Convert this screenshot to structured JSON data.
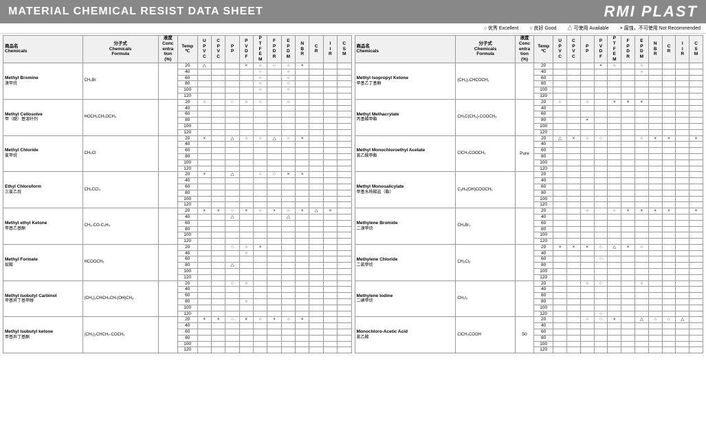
{
  "header": {
    "title": "MATERIAL CHEMICAL RESIST DATA SHEET",
    "logo": "RMI PLAST"
  },
  "legend": {
    "excellent": "优秀 Excellent",
    "good": "良好 Good",
    "available": "可使用 Available",
    "not_recommended": "腐蚀，不可使用 Not Recommended",
    "circle": "○",
    "small_circle": "○",
    "triangle": "△",
    "x": "×"
  },
  "columns": [
    "商品名\nChemicals",
    "分子式\nFormula",
    "液度\nConc\nentra\ntion\n(%)",
    "Temp\n℃",
    "U\nP\nV\nC",
    "C\nP\nV\nC",
    "P\nP",
    "P\nV\nD\nF",
    "P\nT\nF\nE\nM",
    "F\nP\nD\nR",
    "E\nP\nD\nM",
    "N\nB\nR",
    "C\nR",
    "I\nI\nR",
    "C\nS\nM"
  ],
  "temps": [
    20,
    40,
    60,
    80,
    100,
    120
  ],
  "left_chemicals": [
    {
      "name": "Methyl Bromine\n溴甲烷",
      "formula": "CH₃Br",
      "conc": "",
      "rows": [
        {
          "temp": 20,
          "upvc": "△",
          "cpvc": "",
          "pp": "",
          "pvdf": "×",
          "ptfem": "○",
          "fpdr": "○",
          "epdm": "○",
          "nbr": "×",
          "cr": "",
          "iir": "",
          "csm": ""
        },
        {
          "temp": 40,
          "upvc": "",
          "cpvc": "",
          "pp": "",
          "pvdf": "",
          "ptfem": "○",
          "fpdr": "",
          "epdm": "○",
          "nbr": "",
          "cr": "",
          "iir": "",
          "csm": ""
        },
        {
          "temp": 60,
          "upvc": "",
          "cpvc": "",
          "pp": "",
          "pvdf": "",
          "ptfem": "○",
          "fpdr": "",
          "epdm": "○",
          "nbr": "",
          "cr": "",
          "iir": "",
          "csm": ""
        },
        {
          "temp": 80,
          "upvc": "",
          "cpvc": "",
          "pp": "",
          "pvdf": "",
          "ptfem": "○",
          "fpdr": "",
          "epdm": "○",
          "nbr": "",
          "cr": "",
          "iir": "",
          "csm": ""
        },
        {
          "temp": 100,
          "upvc": "",
          "cpvc": "",
          "pp": "",
          "pvdf": "",
          "ptfem": "○",
          "fpdr": "",
          "epdm": "○",
          "nbr": "",
          "cr": "",
          "iir": "",
          "csm": ""
        },
        {
          "temp": 120,
          "upvc": "",
          "cpvc": "",
          "pp": "",
          "pvdf": "",
          "ptfem": "",
          "fpdr": "",
          "epdm": "",
          "nbr": "",
          "cr": "",
          "iir": "",
          "csm": ""
        }
      ]
    },
    {
      "name": "Methyl Cellosolve\n甲（醚）基溶纤剂",
      "formula": "HOCH₂CH₂OCH₃",
      "conc": "",
      "rows": [
        {
          "temp": 20,
          "upvc": "○",
          "cpvc": "",
          "pp": "○",
          "pvdf": "○",
          "ptfem": "○",
          "fpdr": "",
          "epdm": "○",
          "nbr": "",
          "cr": "",
          "iir": "",
          "csm": ""
        },
        {
          "temp": 40
        },
        {
          "temp": 60
        },
        {
          "temp": 80
        },
        {
          "temp": 100
        },
        {
          "temp": 120
        }
      ]
    },
    {
      "name": "Methyl Chloride\n氯甲烷",
      "formula": "CH₃Cl",
      "conc": "",
      "rows": [
        {
          "temp": 20,
          "upvc": "×",
          "cpvc": "",
          "pp": "△",
          "pvdf": "○",
          "ptfem": "○",
          "fpdr": "△",
          "epdm": "○",
          "nbr": "×",
          "cr": "",
          "iir": "",
          "csm": ""
        },
        {
          "temp": 40
        },
        {
          "temp": 60
        },
        {
          "temp": 80
        },
        {
          "temp": 100
        },
        {
          "temp": 120
        }
      ]
    },
    {
      "name": "Ethyl Chloroform\n三氯乙烷",
      "formula": "CH₃CCl₃",
      "conc": "",
      "rows": [
        {
          "temp": 20,
          "upvc": "×",
          "cpvc": "",
          "pp": "△",
          "pvdf": "",
          "ptfem": "○",
          "fpdr": "○",
          "epdm": "×",
          "nbr": "×",
          "cr": "",
          "iir": "",
          "csm": ""
        },
        {
          "temp": 40
        },
        {
          "temp": 60
        },
        {
          "temp": 80
        },
        {
          "temp": 100
        },
        {
          "temp": 120
        }
      ]
    },
    {
      "name": "Methyl ethyl Ketone\n甲基乙基酮",
      "formula": "CH₃-CO-C₂H₅",
      "conc": "",
      "rows": [
        {
          "temp": 20,
          "upvc": "×",
          "cpvc": "×",
          "pp": "○",
          "pvdf": "×",
          "ptfem": "○",
          "fpdr": "×",
          "epdm": "○",
          "nbr": "×",
          "cr": "△",
          "iir": "×",
          "csm": ""
        },
        {
          "temp": 40,
          "upvc": "",
          "cpvc": "",
          "pp": "△",
          "pvdf": "",
          "ptfem": "",
          "fpdr": "",
          "epdm": "△",
          "nbr": "",
          "cr": "",
          "iir": "",
          "csm": ""
        },
        {
          "temp": 60
        },
        {
          "temp": 80
        },
        {
          "temp": 100
        },
        {
          "temp": 120
        }
      ]
    },
    {
      "name": "Methyl Formate\n蚁酸",
      "formula": "HCOOCH₃",
      "conc": "",
      "rows": [
        {
          "temp": 20,
          "upvc": "",
          "cpvc": "",
          "pp": "○",
          "pvdf": "○",
          "ptfem": "×",
          "fpdr": "",
          "epdm": "",
          "nbr": "",
          "cr": "",
          "iir": "",
          "csm": ""
        },
        {
          "temp": 40,
          "upvc": "",
          "cpvc": "",
          "pp": "",
          "pvdf": "○",
          "ptfem": "",
          "fpdr": "",
          "epdm": "",
          "nbr": "",
          "cr": "",
          "iir": "",
          "csm": ""
        },
        {
          "temp": 60
        },
        {
          "temp": 80,
          "upvc": "",
          "cpvc": "",
          "pp": "△",
          "pvdf": "",
          "ptfem": "",
          "fpdr": "",
          "epdm": "",
          "nbr": "",
          "cr": "",
          "iir": "",
          "csm": ""
        },
        {
          "temp": 100
        },
        {
          "temp": 120
        }
      ]
    },
    {
      "name": "Methyl Isobutyl Carbinol\n甲基异丁基甲醇",
      "formula": "(CH₃)₂CHCH₂CH-(OH)CH₃",
      "conc": "",
      "rows": [
        {
          "temp": 20,
          "upvc": "",
          "cpvc": "",
          "pp": "○",
          "pvdf": "○",
          "ptfem": "",
          "fpdr": "",
          "epdm": "",
          "nbr": "",
          "cr": "",
          "iir": "",
          "csm": ""
        },
        {
          "temp": 40
        },
        {
          "temp": 60
        },
        {
          "temp": 80,
          "upvc": "",
          "cpvc": "",
          "pp": "",
          "pvdf": "○",
          "ptfem": "",
          "fpdr": "",
          "epdm": "",
          "nbr": "",
          "cr": "",
          "iir": "",
          "csm": ""
        },
        {
          "temp": 100
        },
        {
          "temp": 120
        }
      ]
    },
    {
      "name": "Methyl Isobutyl ketone\n甲基异丁基酮",
      "formula": "(CH₃)₂CHCH₂-COCH₃",
      "conc": "",
      "rows": [
        {
          "temp": 20,
          "upvc": "×",
          "cpvc": "×",
          "pp": "○",
          "pvdf": "×",
          "ptfem": "○",
          "fpdr": "×",
          "epdm": "○",
          "nbr": "×",
          "cr": "",
          "iir": "",
          "csm": ""
        },
        {
          "temp": 40
        },
        {
          "temp": 60
        },
        {
          "temp": 80
        },
        {
          "temp": 100
        },
        {
          "temp": 120
        }
      ]
    }
  ],
  "right_chemicals": [
    {
      "name": "Methyl Isopropyl Ketone\n甲基乙丁基酮",
      "formula": "(CH₃)₂CHCOCH₃",
      "conc": "",
      "rows": [
        {
          "temp": 20,
          "upvc": "",
          "cpvc": "",
          "pp": "",
          "pvdf": "×",
          "ptfem": "○",
          "fpdr": "",
          "epdm": "○",
          "nbr": "",
          "cr": "",
          "iir": "",
          "csm": ""
        },
        {
          "temp": 40,
          "upvc": "",
          "cpvc": "",
          "pp": "",
          "pvdf": "",
          "ptfem": "",
          "fpdr": "",
          "epdm": "○",
          "nbr": "",
          "cr": "",
          "iir": "",
          "csm": ""
        },
        {
          "temp": 60
        },
        {
          "temp": 80
        },
        {
          "temp": 100
        },
        {
          "temp": 120
        }
      ]
    },
    {
      "name": "Methyl Methacrylate\n丙基酸甲酯",
      "formula": "CH₂C(CH₃)-COOCH₃",
      "conc": "",
      "rows": [
        {
          "temp": 20,
          "upvc": "○",
          "cpvc": "",
          "pp": "○",
          "pvdf": "",
          "ptfem": "×",
          "fpdr": "×",
          "epdm": "×",
          "nbr": "",
          "cr": "",
          "iir": "",
          "csm": ""
        },
        {
          "temp": 40
        },
        {
          "temp": 60
        },
        {
          "temp": 80,
          "upvc": "",
          "cpvc": "",
          "pp": "×",
          "pvdf": "",
          "ptfem": "",
          "fpdr": "",
          "epdm": "",
          "nbr": "",
          "cr": "",
          "iir": "",
          "csm": ""
        },
        {
          "temp": 100
        },
        {
          "temp": 120
        }
      ]
    },
    {
      "name": "Methyl Monochloroethyl Acetate\n氯乙酸甲酯",
      "formula": "ClCH₂COOCH₃",
      "conc": "Pure",
      "rows": [
        {
          "temp": 20,
          "upvc": "△",
          "cpvc": "×",
          "pp": "○",
          "pvdf": "○",
          "ptfem": "",
          "fpdr": "",
          "epdm": "○",
          "nbr": "×",
          "cr": "×",
          "iir": "",
          "csm": "×"
        },
        {
          "temp": 40
        },
        {
          "temp": 60
        },
        {
          "temp": 80
        },
        {
          "temp": 100
        },
        {
          "temp": 120
        }
      ]
    },
    {
      "name": "Methyl Monosalicylate\n甲基水杨酸盐（酯）",
      "formula": "C₆H₄(OH)COOCH₃",
      "conc": "",
      "rows": [
        {
          "temp": 20
        },
        {
          "temp": 40
        },
        {
          "temp": 60
        },
        {
          "temp": 80
        },
        {
          "temp": 100
        },
        {
          "temp": 120
        }
      ]
    },
    {
      "name": "Methylene Bromide\n二溴甲烷",
      "formula": "CH₂Br₂",
      "conc": "",
      "rows": [
        {
          "temp": 20,
          "upvc": "",
          "cpvc": "",
          "pp": "○",
          "pvdf": "",
          "ptfem": "○",
          "fpdr": "×",
          "epdm": "×",
          "nbr": "×",
          "cr": "×",
          "iir": "",
          "csm": "×"
        },
        {
          "temp": 40
        },
        {
          "temp": 60
        },
        {
          "temp": 80
        },
        {
          "temp": 100
        },
        {
          "temp": 120
        }
      ]
    },
    {
      "name": "Methylene Chloride\n二氯甲烷",
      "formula": "CH₂Cl₂",
      "conc": "",
      "rows": [
        {
          "temp": 20,
          "upvc": "×",
          "cpvc": "×",
          "pp": "×",
          "pvdf": "○",
          "ptfem": "△",
          "fpdr": "×",
          "epdm": "○",
          "nbr": "",
          "cr": "",
          "iir": "",
          "csm": ""
        },
        {
          "temp": 40
        },
        {
          "temp": 60,
          "upvc": "",
          "cpvc": "",
          "pp": "",
          "pvdf": "○",
          "ptfem": "",
          "fpdr": "",
          "epdm": "",
          "nbr": "",
          "cr": "",
          "iir": "",
          "csm": ""
        },
        {
          "temp": 80
        },
        {
          "temp": 100
        },
        {
          "temp": 120
        }
      ]
    },
    {
      "name": "Methylene Iodine\n二碘甲烷",
      "formula": "CH₂I₂",
      "conc": "",
      "rows": [
        {
          "temp": 20,
          "upvc": "",
          "cpvc": "",
          "pp": "○",
          "pvdf": "○",
          "ptfem": "",
          "fpdr": "",
          "epdm": "○",
          "nbr": "",
          "cr": "",
          "iir": "",
          "csm": ""
        },
        {
          "temp": 40
        },
        {
          "temp": 60
        },
        {
          "temp": 80
        },
        {
          "temp": 100
        },
        {
          "temp": 120,
          "upvc": "",
          "cpvc": "",
          "pp": "",
          "pvdf": "○",
          "ptfem": "",
          "fpdr": "",
          "epdm": "",
          "nbr": "",
          "cr": "",
          "iir": "",
          "csm": ""
        }
      ]
    },
    {
      "name": "Monochloro-Acetic Acid\n氯乙酸",
      "formula": "ClCH₂COOH",
      "conc": "50",
      "rows": [
        {
          "temp": 20,
          "upvc": "",
          "cpvc": "",
          "pp": "○",
          "pvdf": "○",
          "ptfem": "×",
          "fpdr": "",
          "epdm": "△",
          "nbr": "○",
          "cr": "○",
          "iir": "△",
          "csm": ""
        },
        {
          "temp": 40
        },
        {
          "temp": 60
        },
        {
          "temp": 80
        },
        {
          "temp": 100
        },
        {
          "temp": 120
        }
      ]
    }
  ]
}
